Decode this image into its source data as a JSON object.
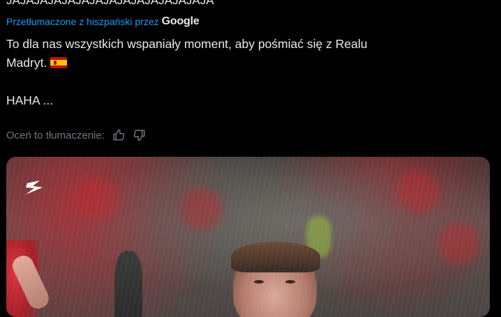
{
  "post": {
    "original_line": "JAJAJAJAJAJAJAJAJAJAJAJAJAJAJA",
    "translated_prefix": "Przetłumaczone z hiszpański przez",
    "translated_brand": "Google",
    "text_line1": "To dla nas wszystkich wspaniały moment, aby pośmiać się z Realu",
    "text_line2": "Madryt.",
    "text_line3": "HAHA ..."
  },
  "rating": {
    "label": "Oceń to tłumaczenie:",
    "thumbs_up_icon": "thumbs-up-icon",
    "thumbs_down_icon": "thumbs-down-icon"
  },
  "colors": {
    "background": "#000000",
    "text": "#e7e9ea",
    "link": "#1d9bf0",
    "muted": "#71767b"
  }
}
